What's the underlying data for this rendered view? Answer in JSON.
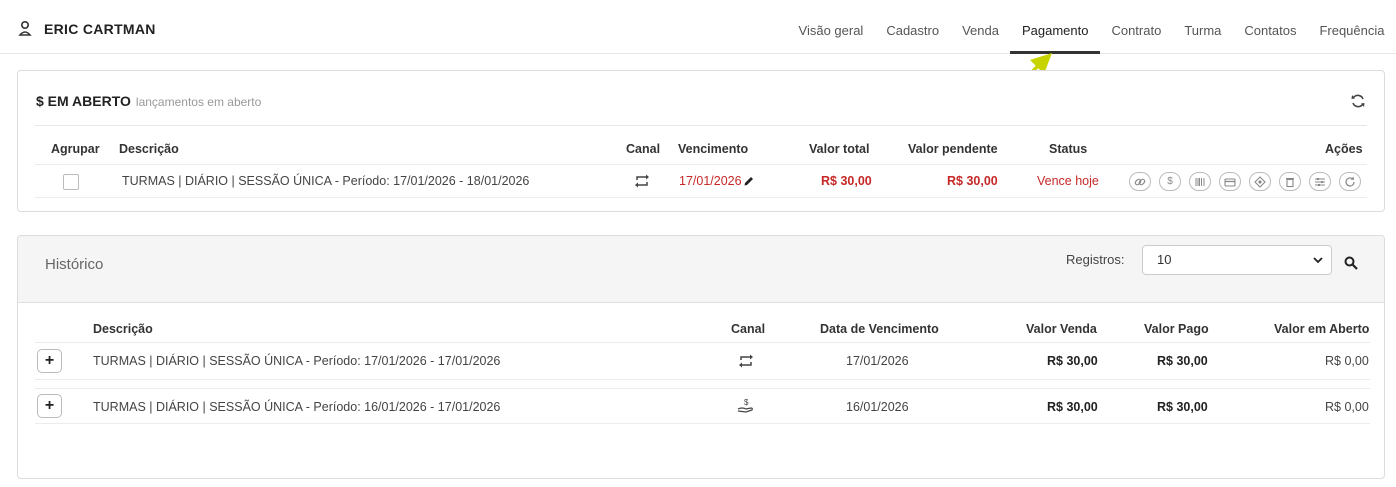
{
  "header": {
    "user_name": "ERIC CARTMAN",
    "tabs": [
      {
        "label": "Visão geral"
      },
      {
        "label": "Cadastro"
      },
      {
        "label": "Venda"
      },
      {
        "label": "Pagamento",
        "active": true
      },
      {
        "label": "Contrato"
      },
      {
        "label": "Turma"
      },
      {
        "label": "Contatos"
      },
      {
        "label": "Frequência"
      }
    ]
  },
  "open": {
    "title": "$ EM ABERTO",
    "subtitle": "lançamentos em aberto",
    "columns": {
      "agrupar": "Agrupar",
      "descricao": "Descrição",
      "canal": "Canal",
      "vencimento": "Vencimento",
      "valor_total": "Valor total",
      "valor_pendente": "Valor pendente",
      "status": "Status",
      "acoes": "Ações"
    },
    "rows": [
      {
        "descricao": "TURMAS | DIÁRIO | SESSÃO ÚNICA - Período: 17/01/2026 - 18/01/2026",
        "canal_icon": "recurring-icon",
        "vencimento": "17/01/2026",
        "valor_total": "R$ 30,00",
        "valor_pendente": "R$ 30,00",
        "status": "Vence hoje"
      }
    ],
    "action_icons": [
      "link-icon",
      "dollar-icon",
      "barcode-icon",
      "credit-card-icon",
      "pix-icon",
      "trash-icon",
      "adjust-icon",
      "refresh-icon"
    ]
  },
  "history": {
    "title": "Histórico",
    "registros_label": "Registros:",
    "registros_value": "10",
    "columns": {
      "descricao": "Descrição",
      "canal": "Canal",
      "data_vencimento": "Data de Vencimento",
      "valor_venda": "Valor Venda",
      "valor_pago": "Valor Pago",
      "valor_aberto": "Valor em Aberto"
    },
    "rows": [
      {
        "descricao": "TURMAS | DIÁRIO | SESSÃO ÚNICA - Período: 17/01/2026 - 17/01/2026",
        "canal_icon": "recurring-icon",
        "data_vencimento": "17/01/2026",
        "valor_venda": "R$ 30,00",
        "valor_pago": "R$ 30,00",
        "valor_aberto": "R$ 0,00"
      },
      {
        "descricao": "TURMAS | DIÁRIO | SESSÃO ÚNICA - Período: 16/01/2026 - 17/01/2026",
        "canal_icon": "hand-money-icon",
        "data_vencimento": "16/01/2026",
        "valor_venda": "R$ 30,00",
        "valor_pago": "R$ 30,00",
        "valor_aberto": "R$ 0,00"
      }
    ]
  },
  "colors": {
    "accent_arrow": "#c8d400",
    "danger": "#c62828"
  }
}
